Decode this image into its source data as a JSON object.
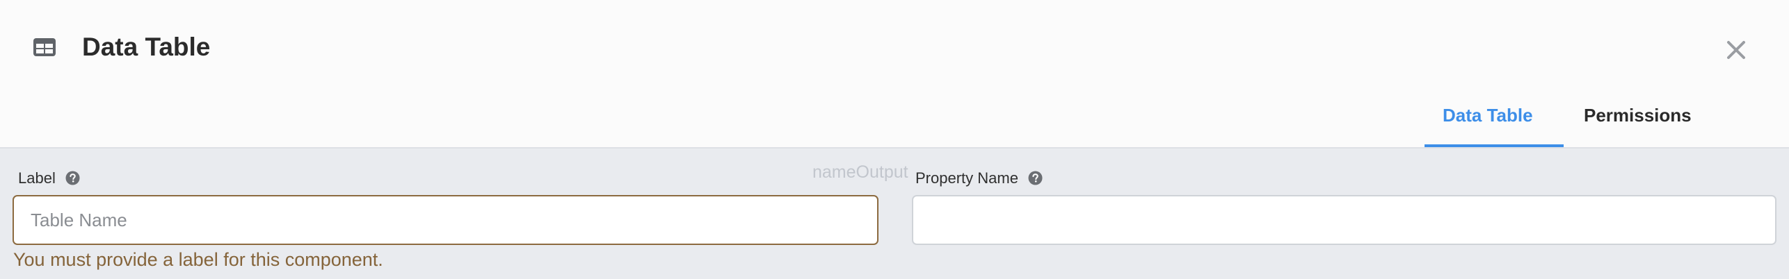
{
  "dialog": {
    "title": "Data Table",
    "title_icon": "table-icon",
    "close_icon": "close-icon"
  },
  "tabs": [
    {
      "label": "Data Table",
      "active": true
    },
    {
      "label": "Permissions",
      "active": false
    }
  ],
  "background_text": "nameOutput",
  "form": {
    "label_field": {
      "label": "Label",
      "placeholder": "Table Name",
      "value": "",
      "error": "You must provide a label for this component."
    },
    "property_field": {
      "label": "Property Name",
      "value": ""
    }
  },
  "colors": {
    "accent": "#3d8ee8",
    "error": "#85643a",
    "error_border": "#8c6a3f"
  }
}
